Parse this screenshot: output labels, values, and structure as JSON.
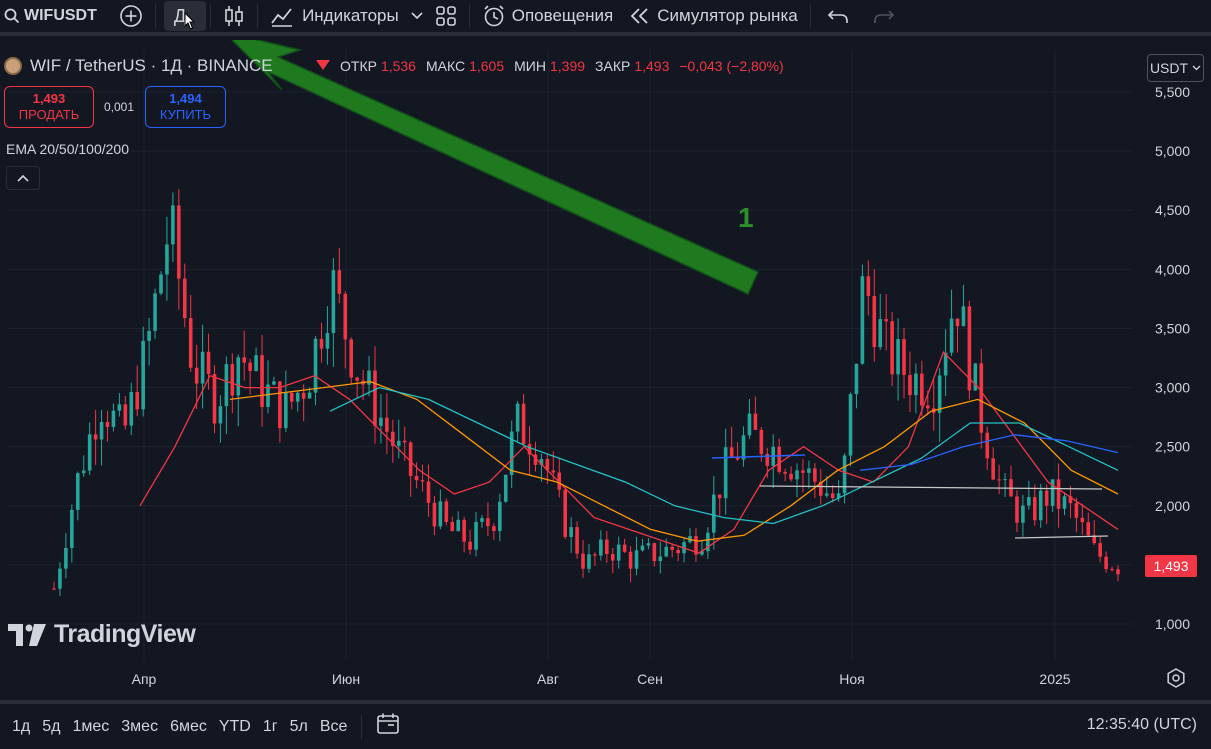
{
  "toolbar": {
    "symbol": "WIFUSDT",
    "interval": "Д",
    "indicators_label": "Индикаторы",
    "alerts_label": "Оповещения",
    "replay_label": "Симулятор рынка"
  },
  "header": {
    "title": "WIF / TetherUS · 1Д · BINANCE",
    "open_label": "ОТКР",
    "open": "1,536",
    "high_label": "МАКС",
    "high": "1,605",
    "low_label": "МИН",
    "low": "1,399",
    "close_label": "ЗАКР",
    "close": "1,493",
    "change": "−0,043 (−2,80%)"
  },
  "trade": {
    "sell_price": "1,493",
    "sell_label": "ПРОДАТЬ",
    "spread": "0,001",
    "buy_price": "1,494",
    "buy_label": "КУПИТЬ"
  },
  "indicator_label": "EMA 20/50/100/200",
  "currency": "USDT",
  "watermark": "TradingView",
  "annotation": "1",
  "last_price": "1,493",
  "price_axis": [
    "5,500",
    "5,000",
    "4,500",
    "4,000",
    "3,500",
    "3,000",
    "2,500",
    "2,000",
    "1,000"
  ],
  "time_axis": [
    "Апр",
    "Июн",
    "Авг",
    "Сен",
    "Ноя",
    "2025"
  ],
  "ranges": [
    "1д",
    "5д",
    "1мес",
    "3мес",
    "6мес",
    "YTD",
    "1г",
    "5л",
    "Все"
  ],
  "clock": "12:35:40 (UTC)",
  "colors": {
    "up": "#26a69a",
    "down": "#f23645",
    "ema20": "#f23645",
    "ema50": "#ff9800",
    "ema100": "#22c3c3",
    "ema200": "#2962ff",
    "arrow": "#1f7a1f",
    "background": "#131722"
  },
  "chart_data": {
    "type": "candlestick",
    "ylim": [
      0.9,
      5.7
    ],
    "series": [
      {
        "name": "WIFUSDT",
        "values": [
          1.3,
          2.2,
          2.9,
          2.6,
          3.3,
          4.4,
          3.2,
          2.9,
          3.3,
          3.0,
          2.8,
          3.1,
          3.9,
          3.2,
          2.8,
          2.4,
          2.1,
          1.8,
          1.7,
          1.9,
          2.7,
          2.5,
          1.9,
          1.5,
          1.65,
          1.55,
          1.6,
          1.65,
          1.75,
          2.3,
          2.6,
          2.5,
          2.35,
          2.2,
          2.0,
          3.9,
          3.3,
          3.1,
          3.0,
          3.8,
          2.8,
          2.1,
          1.9,
          2.1,
          1.95,
          1.6,
          1.5
        ]
      },
      {
        "name": "EMA 20",
        "values": [
          2.0,
          2.5,
          3.1,
          3.0,
          3.0,
          3.1,
          2.9,
          2.6,
          2.3,
          2.1,
          2.2,
          2.5,
          2.2,
          1.9,
          1.8,
          1.7,
          1.6,
          1.8,
          2.3,
          2.5,
          2.3,
          2.2,
          2.5,
          3.3,
          3.0,
          2.6,
          2.2,
          2.0,
          1.8
        ]
      },
      {
        "name": "EMA 50",
        "values": [
          2.9,
          2.95,
          3.0,
          3.05,
          2.9,
          2.6,
          2.3,
          2.2,
          2.0,
          1.8,
          1.7,
          1.75,
          2.0,
          2.3,
          2.5,
          2.8,
          2.9,
          2.7,
          2.3,
          2.1
        ]
      },
      {
        "name": "EMA 100",
        "values": [
          2.8,
          3.0,
          2.9,
          2.7,
          2.5,
          2.35,
          2.2,
          2.0,
          1.9,
          1.85,
          2.0,
          2.2,
          2.4,
          2.7,
          2.7,
          2.5,
          2.3
        ]
      },
      {
        "name": "EMA 200",
        "values": [
          2.3,
          2.35,
          2.5,
          2.6,
          2.55,
          2.45
        ]
      }
    ]
  }
}
